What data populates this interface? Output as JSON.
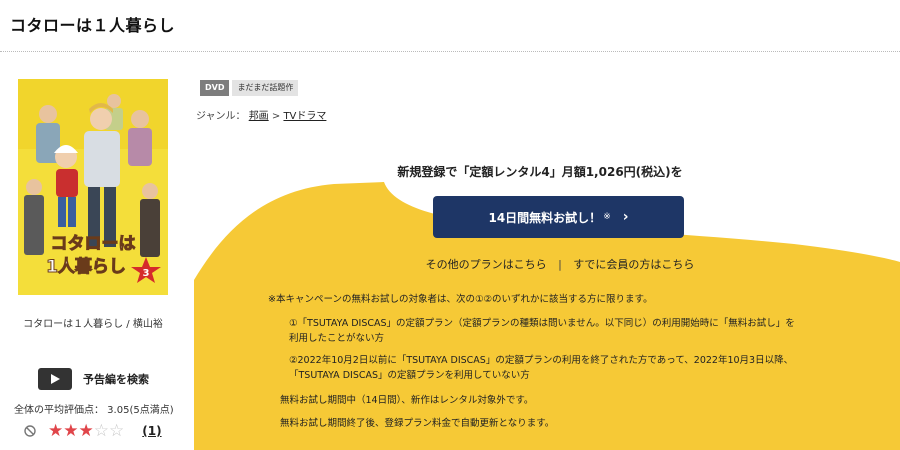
{
  "page": {
    "title": "コタローは１人暮らし"
  },
  "product": {
    "cover_title_line1": "コタローは",
    "cover_title_line2": "1人暮らし",
    "cover_volume": "3",
    "caption": "コタローは１人暮らし / 横山裕",
    "trailer_label": "予告編を検索",
    "rating_text": "全体の平均評価点： 3.05(5点満点)",
    "rating_value": 3,
    "rating_max": 5,
    "review_count": "(1)",
    "badges": {
      "dvd": "DVD",
      "hot": "まだまだ話題作"
    },
    "genre": {
      "prefix": "ジャンル：",
      "cat1": "邦画",
      "sep": ">",
      "cat2": "TVドラマ"
    }
  },
  "campaign": {
    "headline": "新規登録で「定額レンタル4」月額1,026円(税込)を",
    "button_label": "14日間無料お試し！",
    "button_note": "※",
    "other_plans_link": "その他のプランはこちら",
    "separator": "|",
    "member_link": "すでに会員の方はこちら",
    "notes": [
      "※本キャンペーンの無料お試しの対象者は、次の①②のいずれかに該当する方に限ります。",
      "①「TSUTAYA DISCAS」の定額プラン（定額プランの種類は問いません。以下同じ）の利用開始時に「無料お試し」を",
      "利用したことがない方",
      "②2022年10月2日以前に「TSUTAYA DISCAS」の定額プランの利用を終了された方であって、2022年10月3日以降、",
      "「TSUTAYA DISCAS」の定額プランを利用していない方",
      "無料お試し期間中（14日間）、新作はレンタル対象外です。",
      "無料お試し期間終了後、登録プラン料金で自動更新となります。"
    ]
  },
  "colors": {
    "accent_yellow": "#f6c936",
    "button_navy": "#1e3666",
    "star_red": "#e0454a"
  }
}
